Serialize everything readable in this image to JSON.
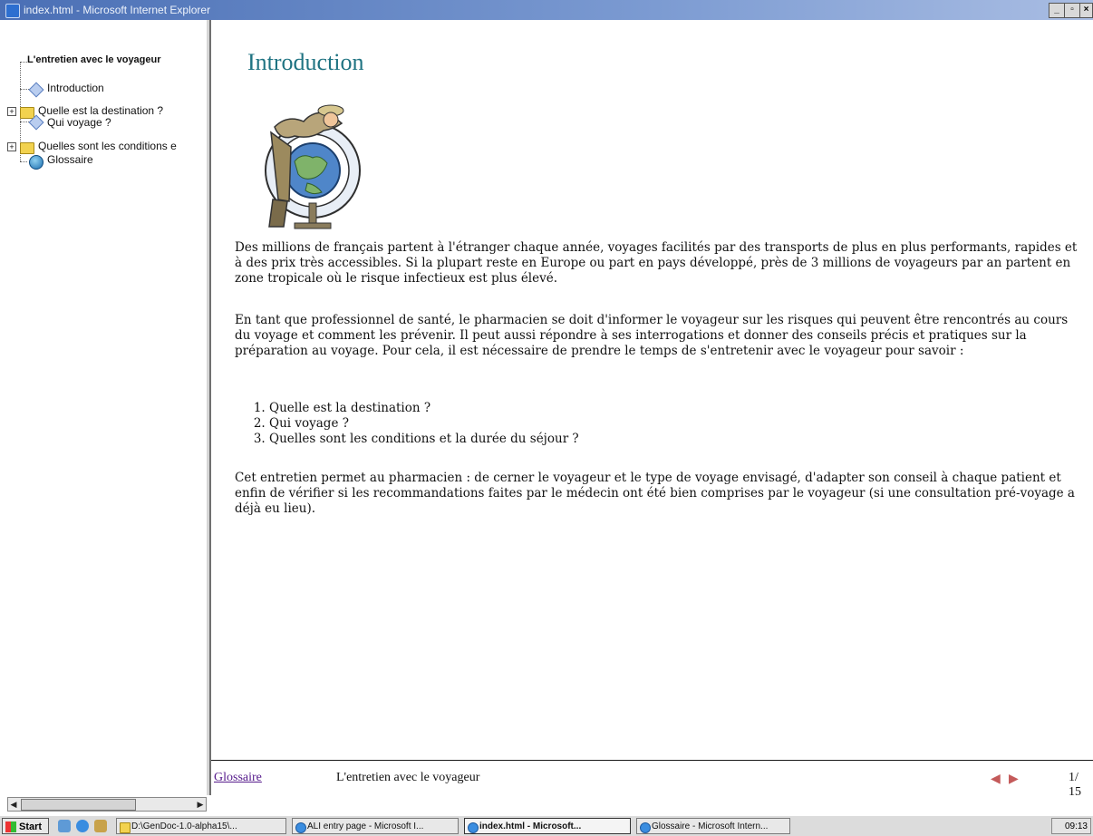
{
  "window": {
    "title": "index.html - Microsoft Internet Explorer",
    "buttons": [
      "_",
      "▫",
      "×"
    ]
  },
  "sidebar": {
    "root_label": "L'entretien avec le voyageur",
    "items": [
      {
        "label": "Introduction",
        "icon": "page-diamond-icon"
      },
      {
        "label": "Quelle est la destination ?",
        "icon": "folder-icon"
      },
      {
        "label": "Qui voyage ?",
        "icon": "page-diamond-icon"
      },
      {
        "label": "Quelles sont les conditions e",
        "icon": "folder-icon"
      },
      {
        "label": "Glossaire",
        "icon": "glossary-book-icon"
      }
    ]
  },
  "main": {
    "title": "Introduction",
    "paragraphs": [
      "Des millions de français partent à l'étranger chaque année, voyages facilités par des transports de plus en plus performants, rapides et à des prix très accessibles. Si la plupart reste en Europe ou part en pays développé, près de 3 millions de voyageurs par an partent en zone tropicale où le risque infectieux est plus élevé.",
      "En tant que professionnel de santé, le pharmacien se doit d'informer le voyageur sur les risques qui peuvent être rencontrés au cours du voyage et comment les prévenir. Il peut aussi répondre à ses interrogations et donner des conseils précis et pratiques sur la préparation au voyage. Pour cela, il est nécessaire de prendre le temps de s'entretenir avec le voyageur pour savoir :",
      "Cet entretien permet au pharmacien : de cerner le voyageur et le type de voyage envisagé, d'adapter son conseil à chaque patient et enfin de vérifier si les recommandations faites par le médecin ont été bien comprises par le voyageur (si une consultation pré-voyage a déjà eu lieu)."
    ],
    "list": [
      "Quelle est la destination ?",
      "Qui voyage ?",
      "Quelles sont les conditions et la durée du séjour ?"
    ]
  },
  "footer": {
    "glossary_link": "Glossaire",
    "section_title": "L'entretien avec le voyageur",
    "page_indicator": "1/ 15",
    "prev_icon": "◀",
    "next_icon": "▶"
  },
  "taskbar": {
    "start_label": "Start",
    "tasks": [
      {
        "label": "D:\\GenDoc-1.0-alpha15\\...",
        "active": false
      },
      {
        "label": "ALI entry page - Microsoft I...",
        "active": false
      },
      {
        "label": "index.html - Microsoft...",
        "active": true
      },
      {
        "label": "Glossaire - Microsoft Intern...",
        "active": false
      }
    ],
    "clock": "09:13"
  },
  "colors": {
    "title_accent": "#1f7382",
    "link": "#551a8b",
    "titlebar": "#4a6fb5"
  }
}
